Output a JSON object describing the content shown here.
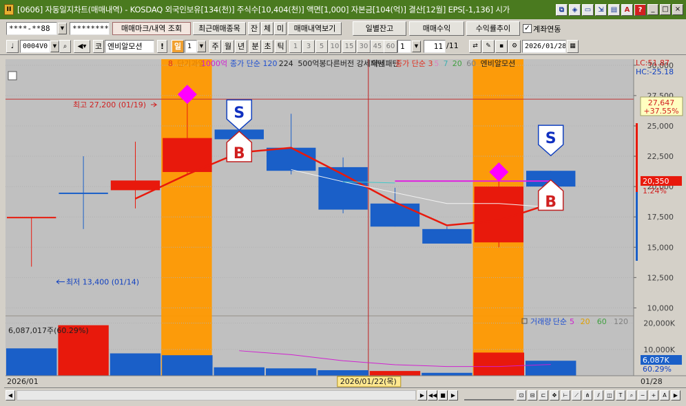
{
  "window": {
    "title": "[0606] 자동일지차트(매매내역) - KOSDAQ 외국인보유[134(천)] 주식수[10,404(천)] 액면[1,000] 자본금[104(억)] 결산[12월] EPS[-1,136] 시가",
    "icon_label": "II",
    "title_icons": [
      "link-icon",
      "chart-icon",
      "window-icon",
      "minimize-to-tray-icon",
      "print-icon",
      "font-icon",
      "help-icon"
    ],
    "title_icon_glyphs": [
      "⧉",
      "◈",
      "▭",
      "⇲",
      "▤",
      "A",
      "?"
    ],
    "controls": [
      "_",
      "□",
      "×"
    ]
  },
  "toolbar1": {
    "account": "****-**88",
    "password": "********",
    "btn_trade_marks": "매매마크/내역 조회",
    "btn_recent_items": "최근매매종목",
    "btn_balance": "잔",
    "btn_trades": "체",
    "btn_pending": "미",
    "btn_history": "매매내역보기",
    "btn_daily_balance": "일별잔고",
    "btn_trade_profit": "매매수익",
    "btn_return_trend": "수익률추이",
    "account_link_label": "계좌연동",
    "account_link_checked": "✓"
  },
  "toolbar2": {
    "stock_code": "0004V0",
    "market": "코",
    "stock_name": "엔비알모션",
    "period_buttons": [
      "일",
      "1",
      "주",
      "월",
      "년",
      "분",
      "초",
      "틱"
    ],
    "interval_buttons": [
      "1",
      "3",
      "5",
      "10",
      "15",
      "30",
      "45",
      "60"
    ],
    "interval_value": "1",
    "count_current": "11",
    "count_total": "/11",
    "date": "2026/01/28"
  },
  "chart_data": [
    {
      "type": "candlestick",
      "title": "",
      "legend": [
        "8",
        "단기과열",
        "1000억",
        "종가 단순 120",
        "224",
        "500억봉다른버전 강세패턴",
        "약세패턴",
        "종가 단순 3",
        "5",
        "7",
        "20",
        "60",
        "엔비알모션"
      ],
      "legend_colors": [
        "#e03020",
        "#e08000",
        "#d020d0",
        "#2050d0",
        "#202020",
        "#202020",
        "#202020",
        "#e03020",
        "#e080c0",
        "#40b0b0",
        "#40a040",
        "#808080",
        "#202020"
      ],
      "x_labels": [
        "2026/01",
        "2026/01/22(목)",
        "01/28"
      ],
      "candles": [
        {
          "date": "01/12",
          "open": 17500,
          "close": 17500,
          "high": 17500,
          "low": 13400,
          "color": "red"
        },
        {
          "date": "01/13",
          "open": 19500,
          "close": 19500,
          "high": 22500,
          "low": 16500,
          "color": "blue"
        },
        {
          "date": "01/14",
          "open": 20500,
          "close": 19700,
          "high": 23700,
          "low": 18200,
          "color": "red"
        },
        {
          "date": "01/15",
          "open": 21200,
          "close": 24000,
          "high": 27200,
          "low": 21000,
          "color": "red"
        },
        {
          "date": "01/16",
          "open": 24700,
          "close": 23900,
          "high": 25700,
          "low": 23700,
          "color": "blue"
        },
        {
          "date": "01/19",
          "open": 23200,
          "close": 21300,
          "high": 26000,
          "low": 21000,
          "color": "blue"
        },
        {
          "date": "01/20",
          "open": 21600,
          "close": 18100,
          "high": 22400,
          "low": 17800,
          "color": "blue"
        },
        {
          "date": "01/21",
          "open": 18600,
          "close": 16700,
          "high": 19900,
          "low": 16700,
          "color": "blue"
        },
        {
          "date": "01/22",
          "open": 16500,
          "close": 15300,
          "high": 16700,
          "low": 15300,
          "color": "blue"
        },
        {
          "date": "01/23",
          "open": 15400,
          "close": 20000,
          "high": 20600,
          "low": 15000,
          "color": "red"
        },
        {
          "date": "01/26",
          "open": 21300,
          "close": 20000,
          "high": 21300,
          "low": 19500,
          "color": "blue"
        }
      ],
      "ma_lines": {
        "red": [
          null,
          null,
          19000,
          21000,
          22800,
          23200,
          21000,
          18700,
          16800,
          17200,
          18600
        ],
        "white": [
          null,
          null,
          null,
          null,
          null,
          21400,
          20400,
          19500,
          18600,
          18600,
          18300
        ],
        "cyan": [
          null,
          null,
          null,
          null,
          null,
          null,
          20400,
          20300,
          null,
          null,
          null
        ],
        "magenta": [
          null,
          null,
          null,
          null,
          null,
          null,
          null,
          20450,
          20450,
          20450,
          20450
        ]
      },
      "highlight_columns": [
        3,
        9
      ],
      "markers": [
        {
          "index": 3,
          "shape": "diamond",
          "color": "#ff00ff",
          "price": 27600
        },
        {
          "index": 9,
          "shape": "diamond",
          "color": "#ff00ff",
          "price": 21200
        },
        {
          "index": 4,
          "shape": "S",
          "price": 25900
        },
        {
          "index": 4,
          "shape": "B",
          "price": 23300
        },
        {
          "index": 10,
          "shape": "S",
          "price": 23800
        },
        {
          "index": 10,
          "shape": "B",
          "price": 19300
        }
      ],
      "y_ticks": [
        10000,
        12500,
        15000,
        17500,
        20000,
        22500,
        25000,
        27500,
        30000
      ],
      "y_tick_labels": [
        "10,000",
        "12,500",
        "15,000",
        "17,500",
        "20,000",
        "22,500",
        "25,000",
        "27,500",
        "30,000"
      ],
      "ylim": [
        9400,
        30500
      ],
      "high_label": "최고 27,200 (01/19)",
      "low_label": "최저 13,400 (01/14)",
      "high_value": 27200,
      "low_value": 13400,
      "hc_label": "HC:-25.18",
      "lc_label": "LC:51.87",
      "last_price_box_top": "27,647",
      "last_price_box_bottom": "+37.55%",
      "last_price": "20,350",
      "last_pct": "1.24%",
      "last_price_value": 20350
    },
    {
      "type": "bar",
      "title": "",
      "legend": [
        "거래량",
        "단순",
        "5",
        "20",
        "60",
        "120"
      ],
      "legend_colors": [
        "#2050d0",
        "#2050d0",
        "#d020d0",
        "#e0a000",
        "#40a040",
        "#808080"
      ],
      "top_label": "6,087,017주(60.29%)",
      "volumes": [
        10400,
        19200,
        8500,
        7800,
        3200,
        2800,
        2100,
        1800,
        1100,
        8800,
        5700
      ],
      "colors": [
        "blue",
        "red",
        "blue",
        "blue",
        "blue",
        "blue",
        "blue",
        "red",
        "blue",
        "red",
        "blue"
      ],
      "ma_line": [
        null,
        null,
        null,
        null,
        9500,
        8000,
        5700,
        4200,
        3500,
        3500,
        4300
      ],
      "y_ticks": [
        10000,
        20000
      ],
      "y_tick_labels": [
        "10,000K",
        "20,000K"
      ],
      "ylim": [
        0,
        22500
      ],
      "last_volume": "6,087K",
      "last_volume_pct": "60.29%"
    }
  ]
}
